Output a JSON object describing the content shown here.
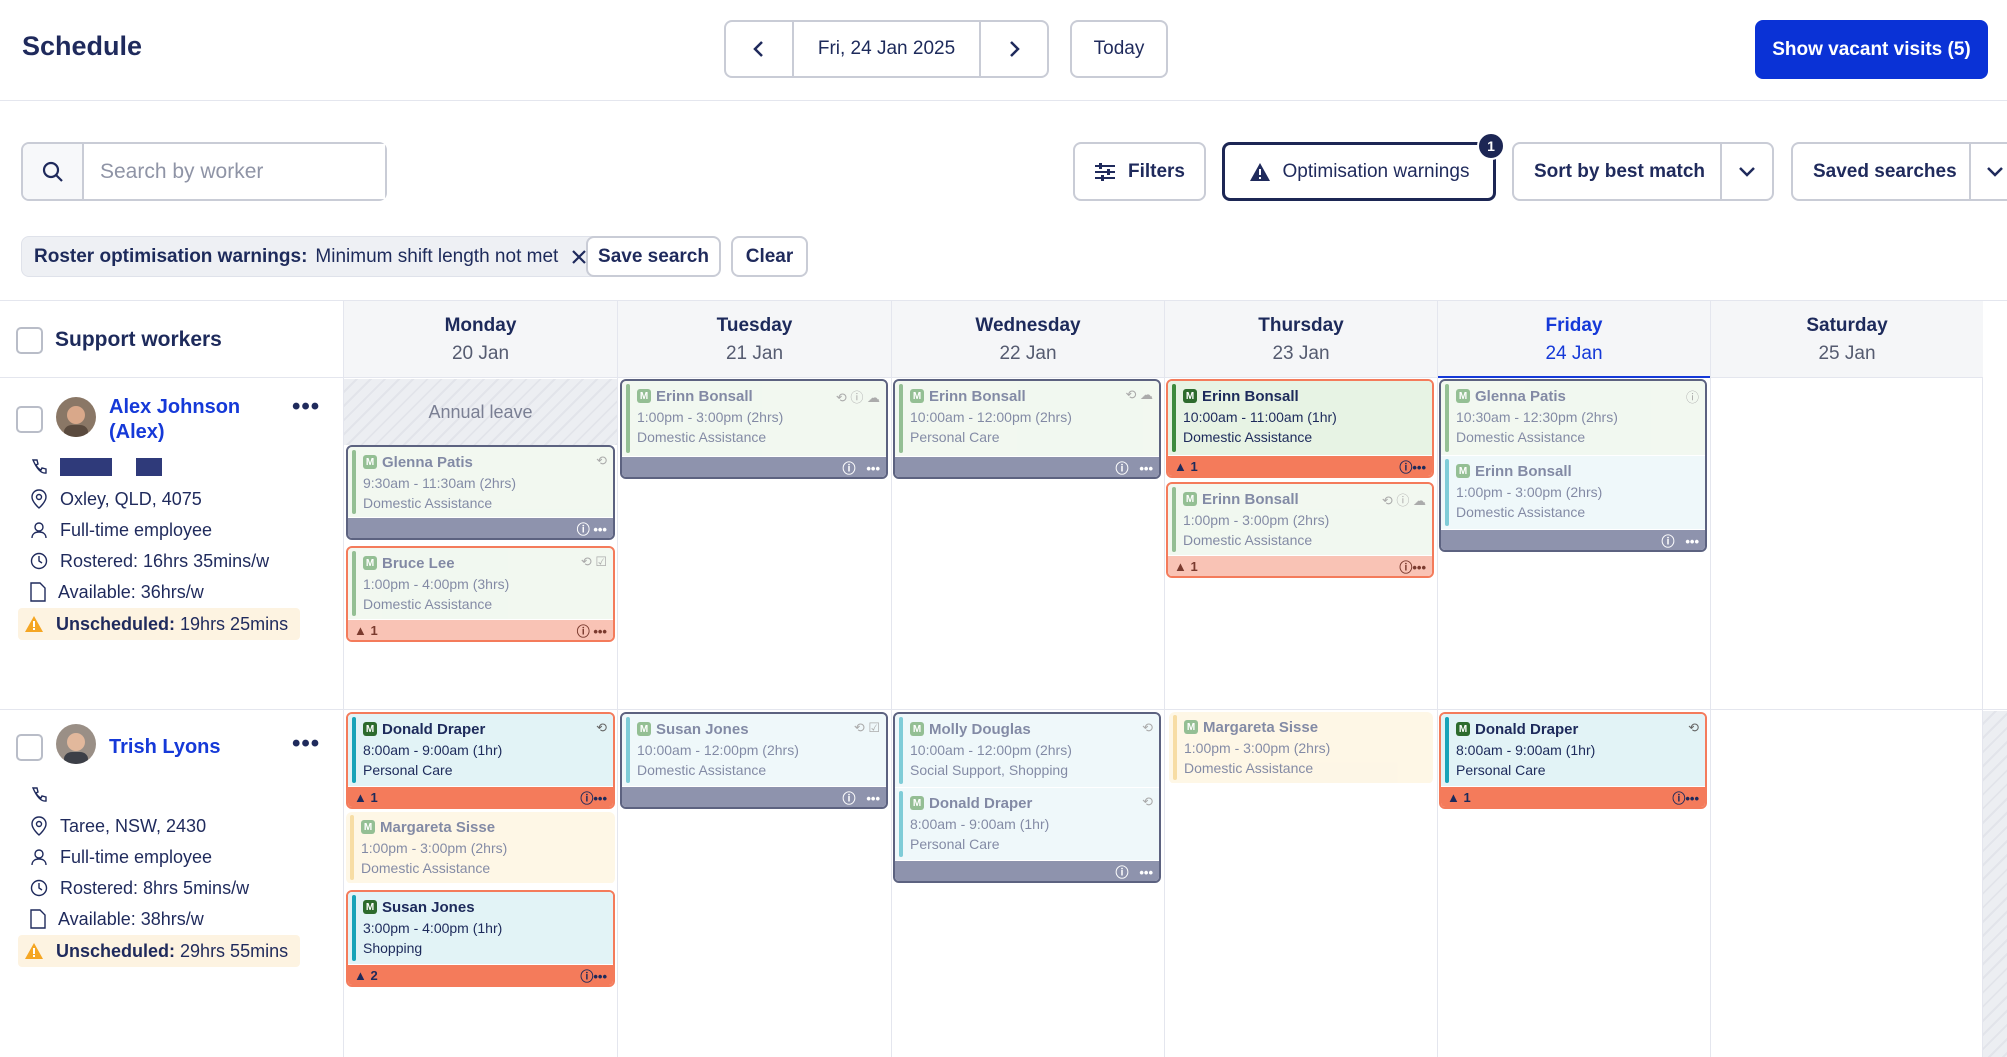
{
  "header": {
    "title": "Schedule",
    "current_date": "Fri, 24 Jan 2025",
    "today_label": "Today",
    "vacant_label": "Show vacant visits (5)"
  },
  "toolbar": {
    "search_placeholder": "Search by worker",
    "filters_label": "Filters",
    "warnings_label": "Optimisation warnings",
    "warnings_badge": "1",
    "sort_label": "Sort by best match",
    "saved_label": "Saved searches"
  },
  "filter_chip": {
    "key": "Roster optimisation warnings:",
    "value": "Minimum shift length not met",
    "save_label": "Save search",
    "clear_label": "Clear"
  },
  "grid": {
    "workers_header": "Support workers",
    "annual_leave": "Annual leave",
    "days": [
      {
        "name": "Monday",
        "date": "20 Jan"
      },
      {
        "name": "Tuesday",
        "date": "21 Jan"
      },
      {
        "name": "Wednesday",
        "date": "22 Jan"
      },
      {
        "name": "Thursday",
        "date": "23 Jan"
      },
      {
        "name": "Friday",
        "date": "24 Jan"
      },
      {
        "name": "Saturday",
        "date": "25 Jan"
      }
    ]
  },
  "workers": [
    {
      "name": "Alex Johnson (Alex)",
      "location": "Oxley, QLD, 4075",
      "employment": "Full-time employee",
      "rostered": "Rostered: 16hrs 35mins/w",
      "available": "Available: 36hrs/w",
      "unscheduled_label": "Unscheduled:",
      "unscheduled_value": "19hrs 25mins"
    },
    {
      "name": "Trish Lyons",
      "location": "Taree, NSW, 2430",
      "employment": "Full-time employee",
      "rostered": "Rostered: 8hrs 5mins/w",
      "available": "Available: 38hrs/w",
      "unscheduled_label": "Unscheduled:",
      "unscheduled_value": "29hrs 55mins"
    }
  ],
  "visits": {
    "r0d0a": {
      "name": "Glenna Patis",
      "time": "9:30am - 11:30am (2hrs)",
      "type": "Domestic Assistance"
    },
    "r0d0b": {
      "name": "Bruce Lee",
      "time": "1:00pm - 4:00pm (3hrs)",
      "type": "Domestic Assistance",
      "warn": "1"
    },
    "r0d1": {
      "name": "Erinn Bonsall",
      "time": "1:00pm - 3:00pm (2hrs)",
      "type": "Domestic Assistance"
    },
    "r0d2": {
      "name": "Erinn Bonsall",
      "time": "10:00am - 12:00pm (2hrs)",
      "type": "Personal Care"
    },
    "r0d3a": {
      "name": "Erinn Bonsall",
      "time": "10:00am - 11:00am (1hr)",
      "type": "Domestic Assistance",
      "warn": "1"
    },
    "r0d3b": {
      "name": "Erinn Bonsall",
      "time": "1:00pm - 3:00pm (2hrs)",
      "type": "Domestic Assistance",
      "warn": "1"
    },
    "r0d4a": {
      "name": "Glenna Patis",
      "time": "10:30am - 12:30pm (2hrs)",
      "type": "Domestic Assistance"
    },
    "r0d4b": {
      "name": "Erinn Bonsall",
      "time": "1:00pm - 3:00pm (2hrs)",
      "type": "Domestic Assistance"
    },
    "r1d0a": {
      "name": "Donald Draper",
      "time": "8:00am - 9:00am (1hr)",
      "type": "Personal Care",
      "warn": "1"
    },
    "r1d0b": {
      "name": "Margareta Sisse",
      "time": "1:00pm - 3:00pm (2hrs)",
      "type": "Domestic Assistance"
    },
    "r1d0c": {
      "name": "Susan Jones",
      "time": "3:00pm - 4:00pm (1hr)",
      "type": "Shopping",
      "warn": "2"
    },
    "r1d1": {
      "name": "Susan Jones",
      "time": "10:00am - 12:00pm (2hrs)",
      "type": "Domestic Assistance"
    },
    "r1d2a": {
      "name": "Molly Douglas",
      "time": "10:00am - 12:00pm (2hrs)",
      "type": "Social Support, Shopping"
    },
    "r1d2b": {
      "name": "Donald Draper",
      "time": "8:00am - 9:00am (1hr)",
      "type": "Personal Care"
    },
    "r1d3": {
      "name": "Margareta Sisse",
      "time": "1:00pm - 3:00pm (2hrs)",
      "type": "Domestic Assistance"
    },
    "r1d4": {
      "name": "Donald Draper",
      "time": "8:00am - 9:00am (1hr)",
      "type": "Personal Care",
      "warn": "1"
    }
  },
  "colors": {
    "primary": "#0a32d6",
    "warning": "#f47b5b",
    "green_bg": "#e7f3e4",
    "blue_bg": "#e2f3f6",
    "yellow_bg": "#fdf6e3",
    "gray_foot": "#8e93ad"
  }
}
